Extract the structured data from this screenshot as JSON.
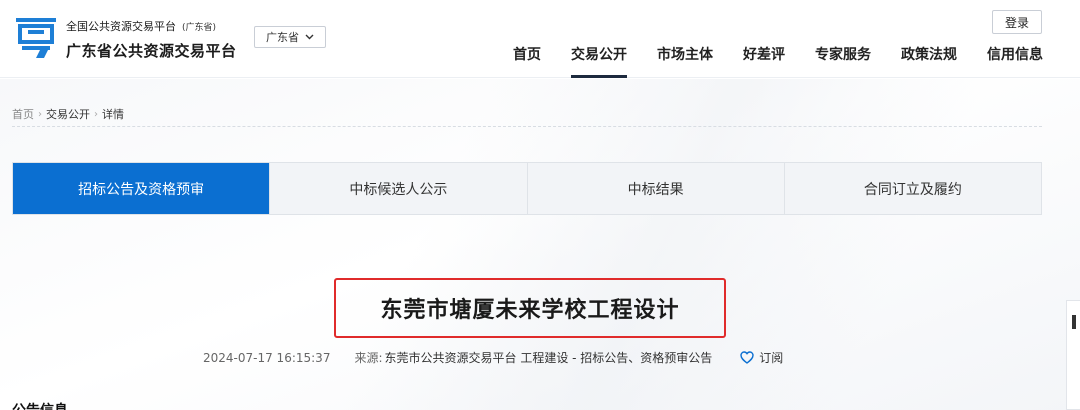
{
  "header": {
    "brand_top": "全国公共资源交易平台",
    "brand_top_sub": "(广东省)",
    "brand_main": "广东省公共资源交易平台",
    "province_select": "广东省",
    "login": "登录",
    "nav": [
      {
        "label": "首页"
      },
      {
        "label": "交易公开",
        "active": true
      },
      {
        "label": "市场主体"
      },
      {
        "label": "好差评"
      },
      {
        "label": "专家服务"
      },
      {
        "label": "政策法规"
      },
      {
        "label": "信用信息"
      }
    ]
  },
  "breadcrumb": {
    "items": [
      "首页",
      "交易公开",
      "详情"
    ],
    "separator": "›"
  },
  "tabs": [
    {
      "label": "招标公告及资格预审",
      "active": true
    },
    {
      "label": "中标候选人公示"
    },
    {
      "label": "中标结果"
    },
    {
      "label": "合同订立及履约"
    }
  ],
  "article": {
    "title": "东莞市塘厦未来学校工程设计",
    "date": "2024-07-17 16:15:37",
    "source_label": "来源:",
    "source_value": "东莞市公共资源交易平台 工程建设 - 招标公告、资格预审公告",
    "subscribe": "订阅",
    "section_head": "公告信息"
  },
  "colors": {
    "accent": "#0b6fd1",
    "logo_blue": "#1e7fd6",
    "highlight_border": "#e02b2b",
    "nav_underline": "#1d2a3e"
  }
}
